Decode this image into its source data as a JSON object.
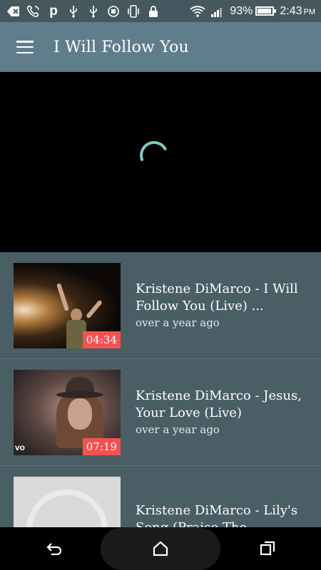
{
  "status_bar": {
    "icons": [
      "usb-debug-icon",
      "phone-call-icon",
      "pandora-icon",
      "usb-icon",
      "usb-icon",
      "rotate-lock-icon",
      "vibrate-icon",
      "lock-icon",
      "wifi-icon",
      "signal-icon"
    ],
    "pandora_glyph": "p",
    "battery_percent": "93%",
    "battery_level": 0.93,
    "time": "2:43",
    "ampm": "PM"
  },
  "app_bar": {
    "title": "I Will Follow You"
  },
  "colors": {
    "status_bar": "#46585f",
    "app_bar": "#607d8b",
    "list_bg": "#4a5e66",
    "duration_badge": "#f55152",
    "spinner": "#7fc8c4"
  },
  "videos": [
    {
      "title": "Kristene DiMarco - I Will Follow You (Live) ...",
      "meta": "over a year ago",
      "duration": "04:34"
    },
    {
      "title": "Kristene DiMarco - Jesus, Your Love (Live)",
      "meta": "over a year ago",
      "duration": "07:19",
      "watermark": "vo"
    },
    {
      "title": "Kristene DiMarco - Lily's Song (Praise The...",
      "meta": "",
      "duration": ""
    }
  ],
  "nav_bar": {
    "back": "back-icon",
    "home": "home-icon",
    "recents": "recents-icon"
  }
}
